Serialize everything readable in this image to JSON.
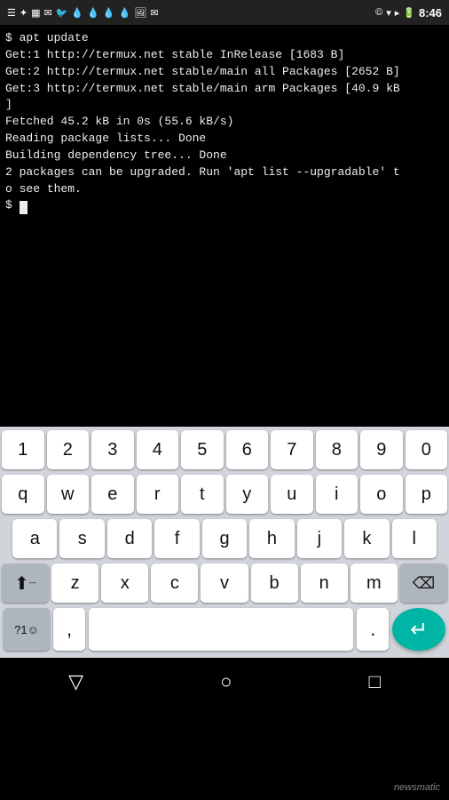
{
  "statusBar": {
    "time": "8:46",
    "leftIcons": [
      "☰",
      "✦",
      "▦",
      "✉",
      "🐦",
      "💧",
      "💧",
      "💧",
      "💧",
      "🖼",
      "✉"
    ],
    "rightIcons": [
      "©",
      "▾",
      "▸",
      "🔋"
    ]
  },
  "terminal": {
    "content": "$ apt update\nGet:1 http://termux.net stable InRelease [1683 B]\nGet:2 http://termux.net stable/main all Packages [2652 B]\nGet:3 http://termux.net stable/main arm Packages [40.9 kB\n]\nFetched 45.2 kB in 0s (55.6 kB/s)\nReading package lists... Done\nBuilding dependency tree... Done\n2 packages can be upgraded. Run 'apt list --upgradable' t\no see them.\n$ "
  },
  "keyboard": {
    "numberRow": [
      "1",
      "2",
      "3",
      "4",
      "5",
      "6",
      "7",
      "8",
      "9",
      "0"
    ],
    "row1": [
      "q",
      "w",
      "e",
      "r",
      "t",
      "y",
      "u",
      "i",
      "o",
      "p"
    ],
    "row2": [
      "a",
      "s",
      "d",
      "f",
      "g",
      "h",
      "j",
      "k",
      "l"
    ],
    "row3": [
      "z",
      "x",
      "c",
      "v",
      "b",
      "n",
      "m"
    ],
    "bottomRow": {
      "special": "?1☺",
      "comma": ",",
      "space": "",
      "period": ".",
      "return": "↵"
    },
    "shift": "⬆",
    "backspace": "⌫"
  },
  "navBar": {
    "back": "▽",
    "home": "○",
    "recent": "□"
  },
  "watermark": "newsmatic"
}
